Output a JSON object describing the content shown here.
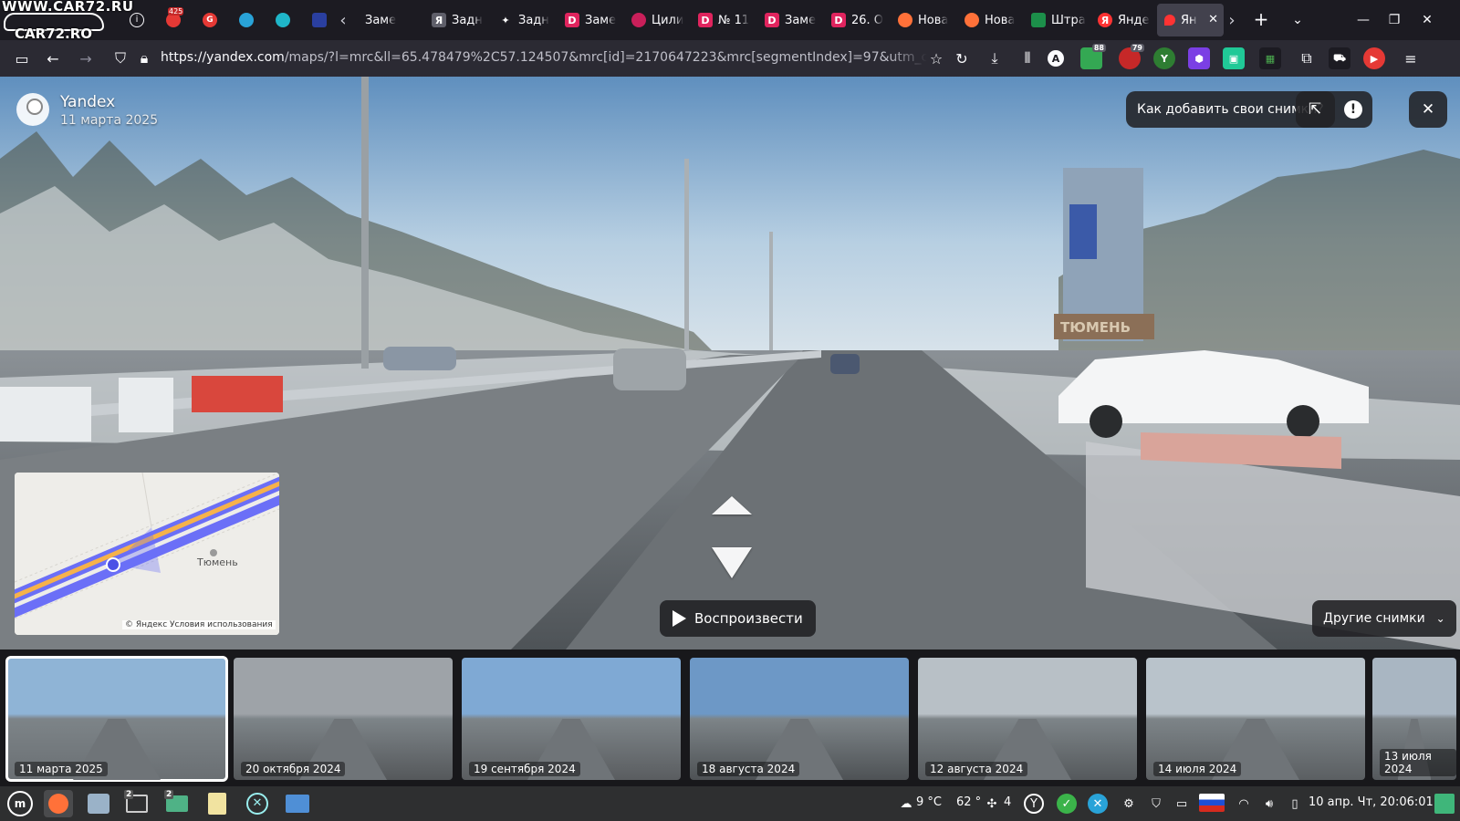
{
  "watermark": {
    "top": "WWW.CAR72.RU",
    "bottom": "CAR72.RO"
  },
  "tabs": [
    {
      "label": "Заме",
      "color": "#42414d",
      "glyph": ""
    },
    {
      "label": "Задн",
      "color": "#5f5f6a",
      "glyph": "Я"
    },
    {
      "label": "Задн",
      "color": "#1c1b22",
      "glyph": "✦"
    },
    {
      "label": "Заме",
      "color": "#e0245e",
      "glyph": "D"
    },
    {
      "label": "Цили",
      "color": "#c91f5a",
      "glyph": "○"
    },
    {
      "label": "№ 11",
      "color": "#e0245e",
      "glyph": "D"
    },
    {
      "label": "Заме",
      "color": "#e0245e",
      "glyph": "D"
    },
    {
      "label": "26. О",
      "color": "#e0245e",
      "glyph": "D"
    },
    {
      "label": "Нова",
      "color": "#ff7139",
      "glyph": "◉"
    },
    {
      "label": "Нова",
      "color": "#ff7139",
      "glyph": "◉"
    },
    {
      "label": "Штра",
      "color": "#1c8f4a",
      "glyph": "▣"
    },
    {
      "label": "Янде",
      "color": "#ff3333",
      "glyph": "Я"
    },
    {
      "label": "Ян",
      "color": "#ff3333",
      "glyph": "●"
    }
  ],
  "url": {
    "host": "https://yandex.com",
    "rest": "/maps/?l=mrc&ll=65.478479%2C57.124507&mrc[id]=2170647223&mrc[segmentIndex]=97&utm_campaign=desktop"
  },
  "extensions": {
    "badge1": "88",
    "badge2": "79",
    "account": "A"
  },
  "pinned": {
    "badge": "425"
  },
  "panorama": {
    "author": "Yandex",
    "date": "11 марта 2025",
    "howto": "Как добавить свои снимки?",
    "city": "Тюмень",
    "copyright": "© Яндекс   Условия использования",
    "play": "Воспроизвести",
    "others": "Другие снимки",
    "sign": "ТЮМЕНЬ"
  },
  "thumbnails": [
    {
      "date": "11 марта 2025",
      "sky": "#8fb4d6",
      "ground": "#6a6f73"
    },
    {
      "date": "20 октября 2024",
      "sky": "#9ea3a8",
      "ground": "#55585b"
    },
    {
      "date": "19 сентября 2024",
      "sky": "#7fa9d4",
      "ground": "#5a5d60"
    },
    {
      "date": "18 августа 2024",
      "sky": "#6d98c6",
      "ground": "#4e5255"
    },
    {
      "date": "12 августа 2024",
      "sky": "#b8c0c6",
      "ground": "#55595c"
    },
    {
      "date": "14 июля 2024",
      "sky": "#b9c3cb",
      "ground": "#5b5f62"
    },
    {
      "date": "13 июля 2024",
      "sky": "#a9b6c2",
      "ground": "#55595d"
    }
  ],
  "taskbar": {
    "weather": "9 °C",
    "temp": "62 °",
    "count": "4",
    "clock": "10 апр. Чт, 20:06:01",
    "ws1": "2",
    "ws2": "2"
  },
  "colors": {
    "accent": "#fbfbfe",
    "chrome": "#1c1b22",
    "toolbar": "#2b2a33",
    "route": "#6b6ff7",
    "road": "#f6b24a"
  }
}
